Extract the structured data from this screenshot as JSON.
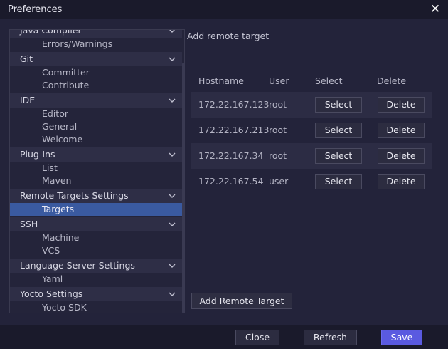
{
  "window": {
    "title": "Preferences",
    "close_glyph": "✕"
  },
  "sidebar": {
    "items": [
      {
        "kind": "head",
        "label": "Java Compiler"
      },
      {
        "kind": "item",
        "label": "Errors/Warnings"
      },
      {
        "kind": "head",
        "label": "Git"
      },
      {
        "kind": "item",
        "label": "Committer"
      },
      {
        "kind": "item",
        "label": "Contribute"
      },
      {
        "kind": "head",
        "label": "IDE"
      },
      {
        "kind": "item",
        "label": "Editor"
      },
      {
        "kind": "item",
        "label": "General"
      },
      {
        "kind": "item",
        "label": "Welcome"
      },
      {
        "kind": "head",
        "label": "Plug-Ins"
      },
      {
        "kind": "item",
        "label": "List"
      },
      {
        "kind": "item",
        "label": "Maven"
      },
      {
        "kind": "head",
        "label": "Remote Targets Settings"
      },
      {
        "kind": "item",
        "label": "Targets",
        "selected": true
      },
      {
        "kind": "head",
        "label": "SSH"
      },
      {
        "kind": "item",
        "label": "Machine"
      },
      {
        "kind": "item",
        "label": "VCS"
      },
      {
        "kind": "head",
        "label": "Language Server Settings"
      },
      {
        "kind": "item",
        "label": "Yaml"
      },
      {
        "kind": "head",
        "label": "Yocto Settings"
      },
      {
        "kind": "item",
        "label": "Yocto SDK"
      }
    ]
  },
  "main": {
    "title": "Add remote target",
    "columns": [
      "Hostname",
      "User",
      "Select",
      "Delete"
    ],
    "rows": [
      {
        "hostname": "172.22.167.123",
        "user": "root",
        "select": "Select",
        "delete": "Delete"
      },
      {
        "hostname": "172.22.167.213",
        "user": "root",
        "select": "Select",
        "delete": "Delete"
      },
      {
        "hostname": "172.22.167.34",
        "user": "root",
        "select": "Select",
        "delete": "Delete"
      },
      {
        "hostname": "172.22.167.54",
        "user": "user",
        "select": "Select",
        "delete": "Delete"
      }
    ],
    "add_button": "Add Remote Target"
  },
  "footer": {
    "close": "Close",
    "refresh": "Refresh",
    "save": "Save"
  },
  "colors": {
    "accent": "#5a5ae0",
    "selection": "#3a5aa0",
    "background": "#23233a"
  }
}
